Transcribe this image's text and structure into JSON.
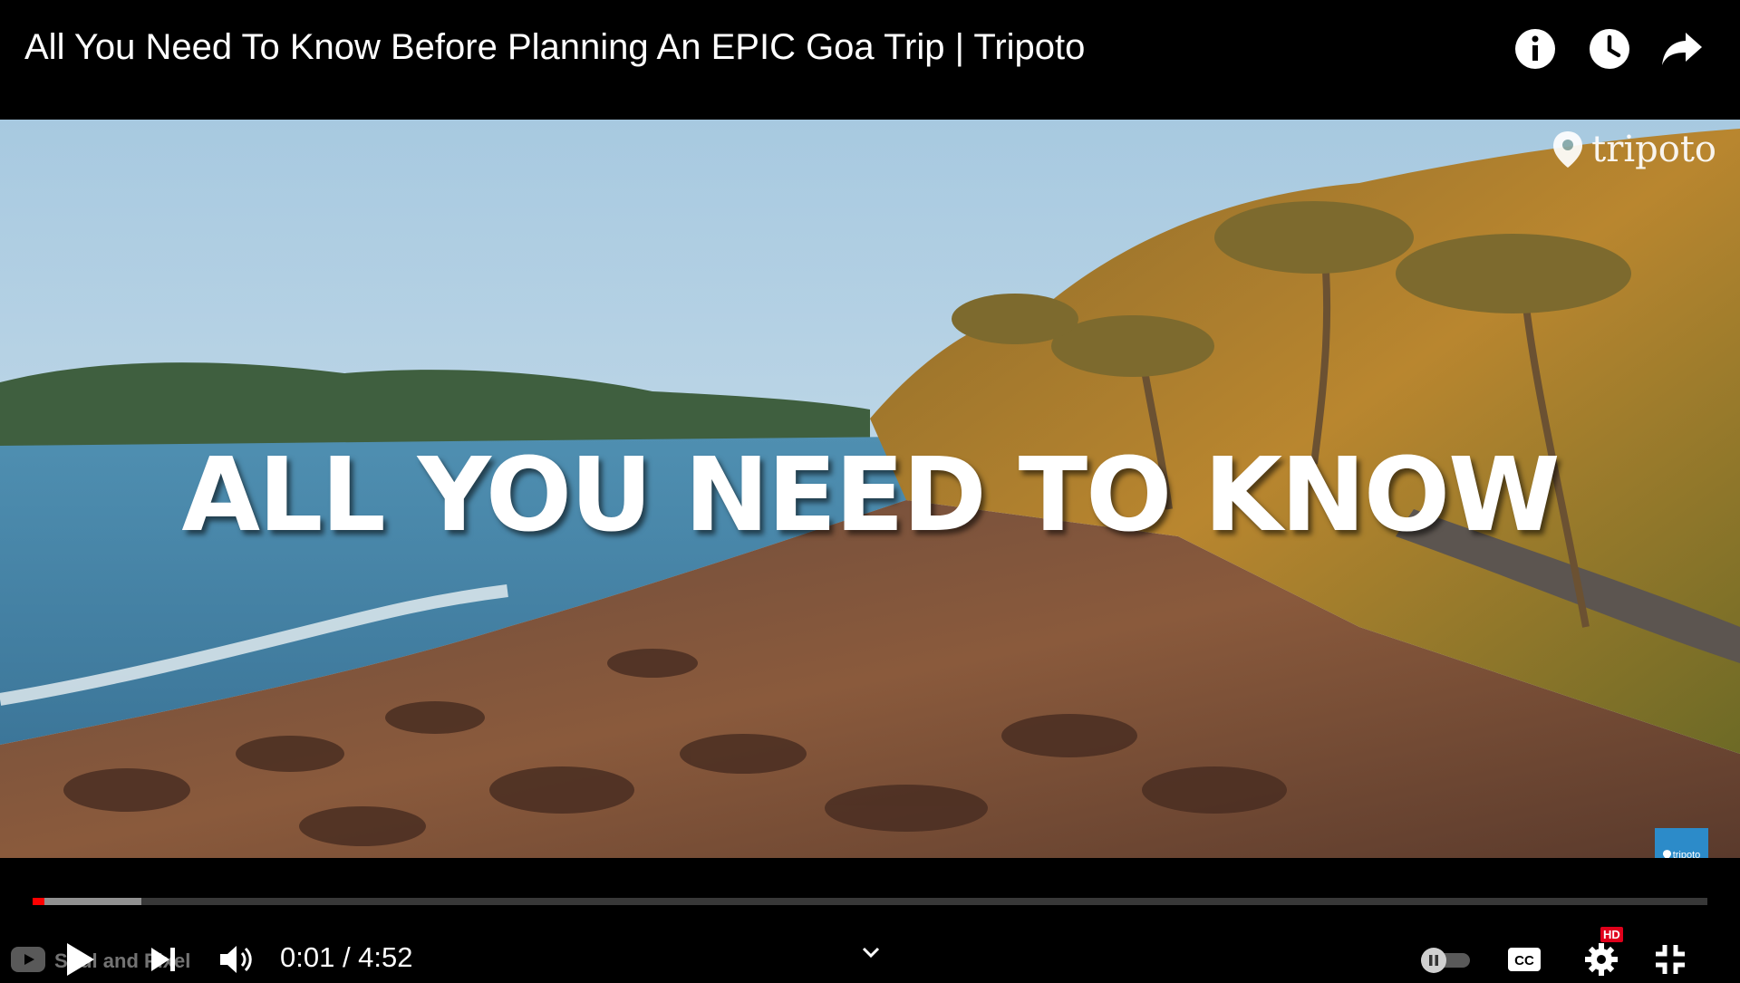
{
  "header": {
    "title": "All You Need To Know Before Planning An EPIC Goa Trip | Tripoto",
    "icons": [
      "info-icon",
      "watch-later-clock-icon",
      "share-arrow-icon"
    ]
  },
  "video": {
    "overlay_text": "ALL YOU NEED TO KNOW",
    "brand_logo": "tripoto",
    "watermark_label": "tripoto"
  },
  "controls": {
    "current_time": "0:01",
    "separator": "/",
    "duration": "4:52",
    "time_display": "0:01 / 4:52",
    "up_next_channel": "Soul and Pixel",
    "played_fraction": 0.007,
    "loaded_fraction": 0.065,
    "quality_badge": "HD",
    "icons": [
      "youtube-icon",
      "play-icon",
      "next-icon",
      "volume-icon",
      "chevron-down-icon",
      "autoplay-toggle-icon",
      "captions-icon",
      "settings-gear-icon",
      "exit-fullscreen-icon"
    ]
  },
  "colors": {
    "accent": "#ff0000",
    "background": "#000000",
    "watermark": "#2c8bc9",
    "hd_badge": "#e0001b"
  }
}
